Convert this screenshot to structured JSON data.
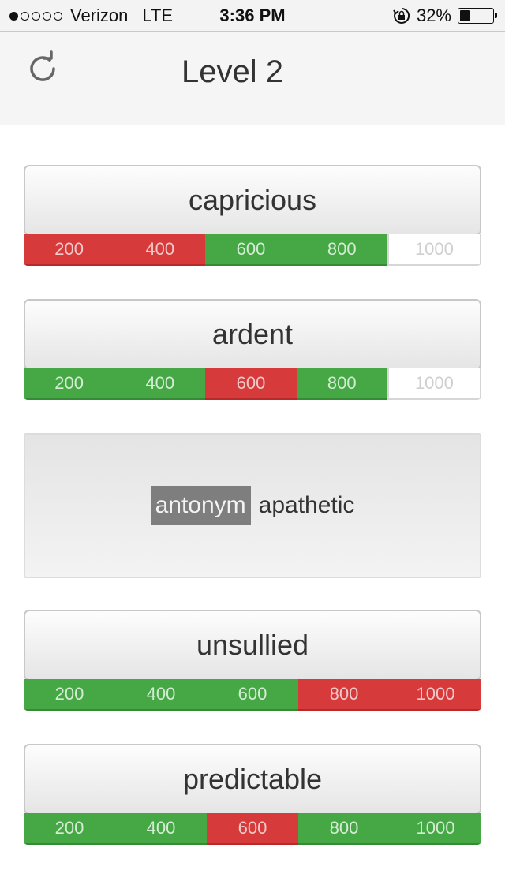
{
  "status_bar": {
    "signal_dots": [
      true,
      false,
      false,
      false,
      false
    ],
    "carrier": "Verizon",
    "network": "LTE",
    "time": "3:36 PM",
    "battery_percent_text": "32%",
    "battery_level": 0.32
  },
  "nav": {
    "title": "Level 2",
    "refresh_icon": "refresh-icon"
  },
  "colors": {
    "wrong": "#d63a3a",
    "correct": "#45a845",
    "unplayed": "#ffffff"
  },
  "cards": [
    {
      "word": "capricious",
      "scores": [
        {
          "label": "200",
          "state": "red"
        },
        {
          "label": "400",
          "state": "red"
        },
        {
          "label": "600",
          "state": "green"
        },
        {
          "label": "800",
          "state": "green"
        },
        {
          "label": "1000",
          "state": "white"
        }
      ]
    },
    {
      "word": "ardent",
      "scores": [
        {
          "label": "200",
          "state": "green"
        },
        {
          "label": "400",
          "state": "green"
        },
        {
          "label": "600",
          "state": "red"
        },
        {
          "label": "800",
          "state": "green"
        },
        {
          "label": "1000",
          "state": "white"
        }
      ]
    },
    {
      "word": "unsullied",
      "scores": [
        {
          "label": "200",
          "state": "green"
        },
        {
          "label": "400",
          "state": "green"
        },
        {
          "label": "600",
          "state": "green"
        },
        {
          "label": "800",
          "state": "red"
        },
        {
          "label": "1000",
          "state": "red"
        }
      ]
    },
    {
      "word": "predictable",
      "scores": [
        {
          "label": "200",
          "state": "green"
        },
        {
          "label": "400",
          "state": "green"
        },
        {
          "label": "600",
          "state": "red"
        },
        {
          "label": "800",
          "state": "green"
        },
        {
          "label": "1000",
          "state": "green"
        }
      ]
    }
  ],
  "hint": {
    "tag": "antonym",
    "word": "apathetic"
  }
}
